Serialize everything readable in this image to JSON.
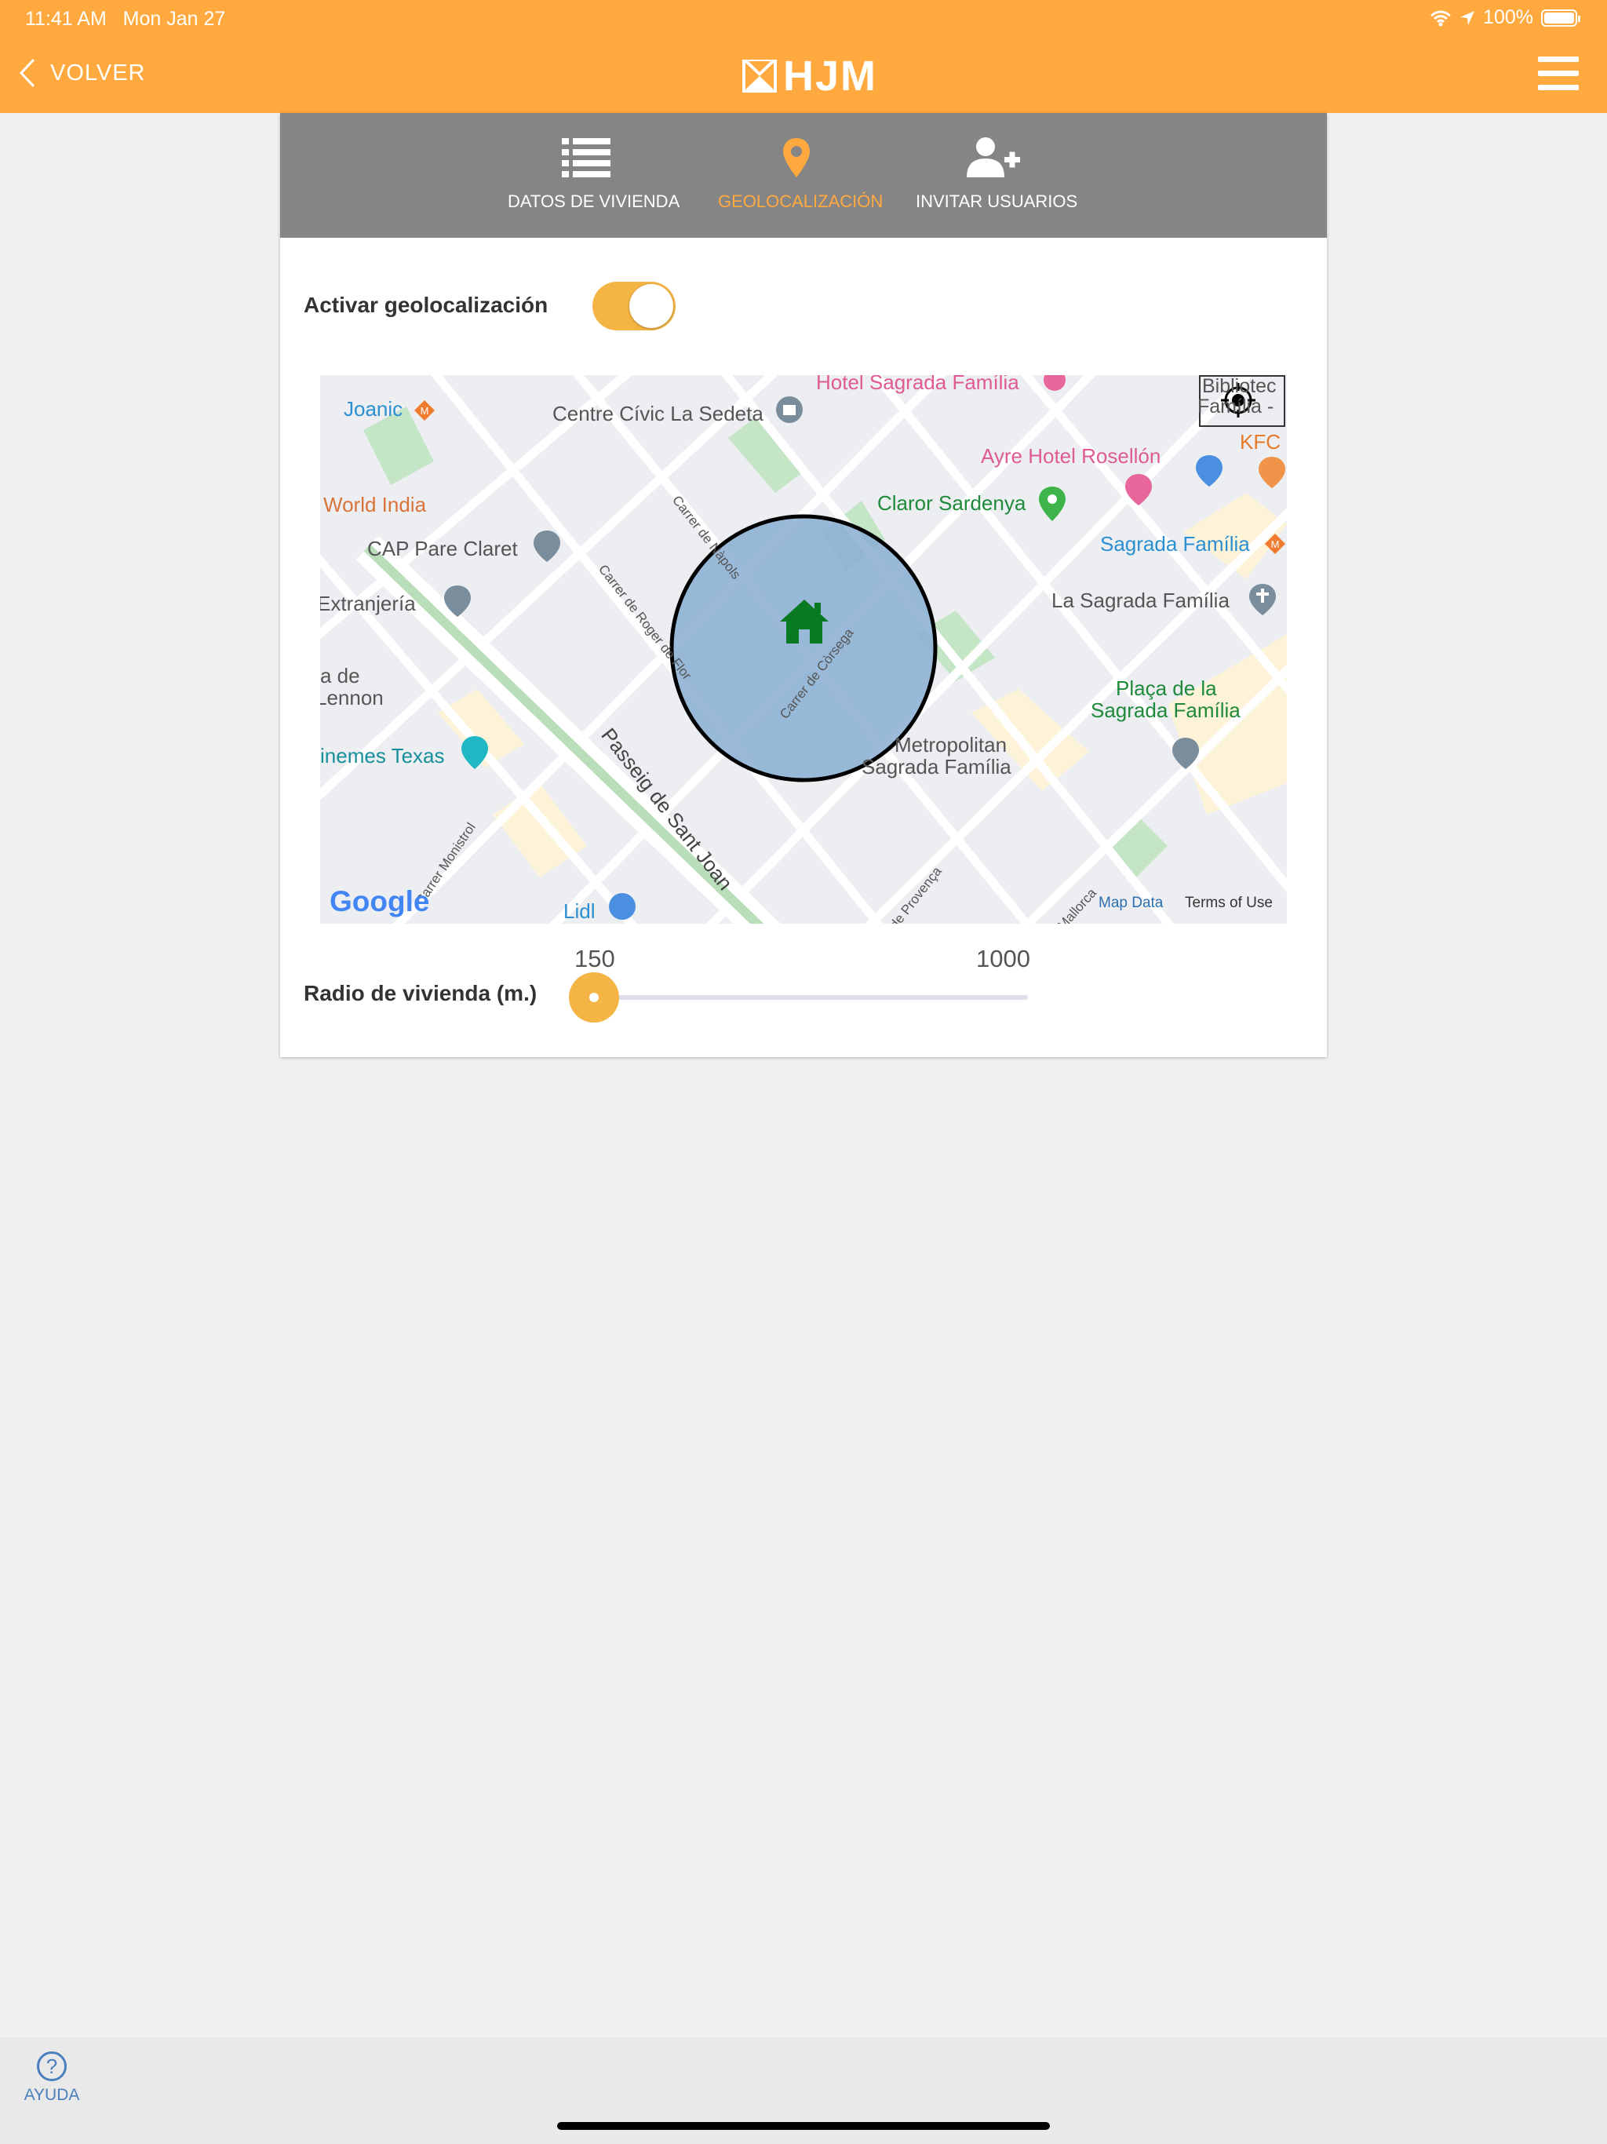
{
  "status_bar": {
    "time": "11:41 AM",
    "date": "Mon Jan 27",
    "battery": "100%"
  },
  "header": {
    "back_label": "VOLVER",
    "logo_text": "HJM",
    "brand_color": "#ffa93f"
  },
  "tabs": [
    {
      "label": "DATOS DE VIVIENDA",
      "icon": "list-icon",
      "active": false
    },
    {
      "label": "GEOLOCALIZACIÓN",
      "icon": "map-pin-icon",
      "active": true
    },
    {
      "label": "INVITAR USUARIOS",
      "icon": "add-user-icon",
      "active": false
    }
  ],
  "geolocation": {
    "label": "Activar geolocalización",
    "enabled": true
  },
  "map": {
    "places": {
      "joanic": "Joanic",
      "centre_civic": "Centre Cívic La Sedeta",
      "hotel": "Hotel Sagrada Família",
      "biblioteca_line1": "Bibliotec",
      "biblioteca_line2": "Família -",
      "kfc": "KFC",
      "ayre": "Ayre Hotel Rosellón",
      "world_india": "World India",
      "claror": "Claror Sardenya",
      "cap": "CAP Pare Claret",
      "sagrada_metro": "Sagrada Família",
      "extranjeria": "Extranjería",
      "la_sagrada": "La Sagrada Família",
      "a_de": "a de",
      "lennon": "Lennon",
      "placa_line1": "Plaça de la",
      "placa_line2": "Sagrada Família",
      "cinemes": "inemes Texas",
      "metropolitan_line1": "Metropolitan",
      "metropolitan_line2": "Sagrada Família",
      "lidl": "Lidl"
    },
    "streets": {
      "napols": "Carrer de Nàpols",
      "roger": "Carrer de Roger de Flor",
      "corsega": "Carrer de Còrsega",
      "sant_joan": "Passeig de Sant Joan",
      "monistrol": "Carrer Monistrol",
      "provenca": "de Provença",
      "mallorca": "Mallorca"
    },
    "google": "Google",
    "map_data": "Map Data",
    "terms": "Terms of Use"
  },
  "radius": {
    "label": "Radio de vivienda (m.)",
    "min": "150",
    "max": "1000",
    "value": 150
  },
  "footer": {
    "help_label": "AYUDA"
  }
}
